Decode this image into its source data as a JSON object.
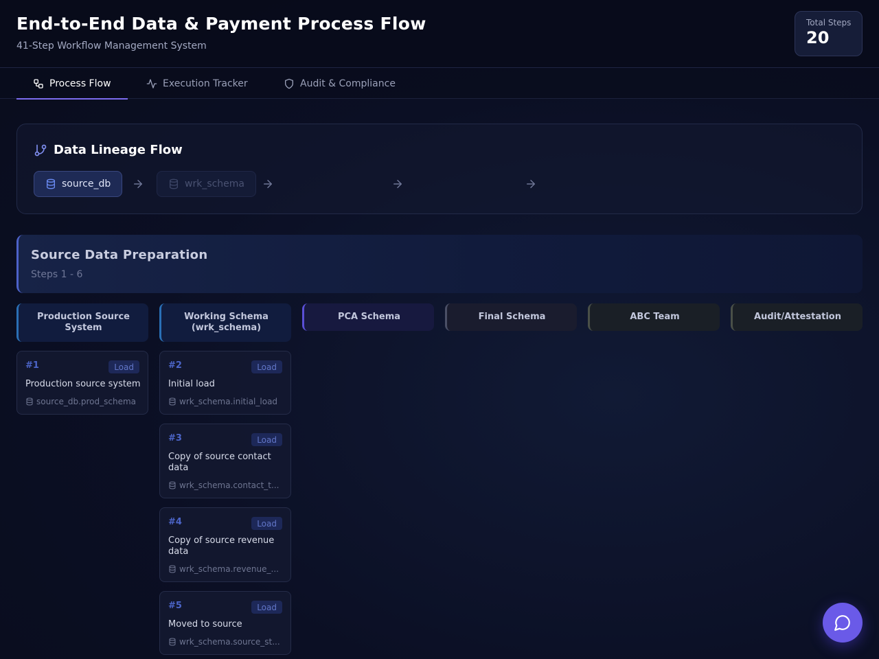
{
  "header": {
    "title": "End-to-End Data & Payment Process Flow",
    "subtitle": "41-Step Workflow Management System",
    "total_steps_label": "Total Steps",
    "total_steps_value": "20"
  },
  "tabs": [
    {
      "label": "Process Flow",
      "icon": "workflow-icon",
      "active": true
    },
    {
      "label": "Execution Tracker",
      "icon": "activity-icon",
      "active": false
    },
    {
      "label": "Audit & Compliance",
      "icon": "shield-icon",
      "active": false
    }
  ],
  "lineage": {
    "title": "Data Lineage Flow",
    "nodes": [
      {
        "label": "source_db",
        "icon": "database-icon"
      },
      {
        "label": "wrk_schema",
        "icon": "database-icon"
      }
    ]
  },
  "phase": {
    "title": "Source Data Preparation",
    "subtitle": "Steps 1 - 6"
  },
  "columns": [
    {
      "label": "Production Source System",
      "accent": "#2a6fb5"
    },
    {
      "label": "Working Schema (wrk_schema)",
      "accent": "#2a6fb5"
    },
    {
      "label": "PCA Schema",
      "accent": "#5a4fd6"
    },
    {
      "label": "Final Schema",
      "accent": "#4a4f66"
    },
    {
      "label": "ABC Team",
      "accent": "#4a5048"
    },
    {
      "label": "Audit/Attestation",
      "accent": "#4a5048"
    }
  ],
  "steps": [
    {
      "num": "#1",
      "badge": "Load",
      "desc": "Production source system",
      "table": "source_db.prod_schema",
      "column": 0
    },
    {
      "num": "#2",
      "badge": "Load",
      "desc": "Initial load",
      "table": "wrk_schema.initial_load",
      "column": 1
    },
    {
      "num": "#3",
      "badge": "Load",
      "desc": "Copy of source contact data",
      "table": "wrk_schema.contact_t...",
      "column": 1
    },
    {
      "num": "#4",
      "badge": "Load",
      "desc": "Copy of source revenue data",
      "table": "wrk_schema.revenue_...",
      "column": 1
    },
    {
      "num": "#5",
      "badge": "Load",
      "desc": "Moved to source",
      "table": "wrk_schema.source_st...",
      "column": 1
    }
  ],
  "colors": {
    "accent": "#7c6cf0",
    "badge_text": "#6276c8",
    "step_number": "#4c65c8"
  }
}
